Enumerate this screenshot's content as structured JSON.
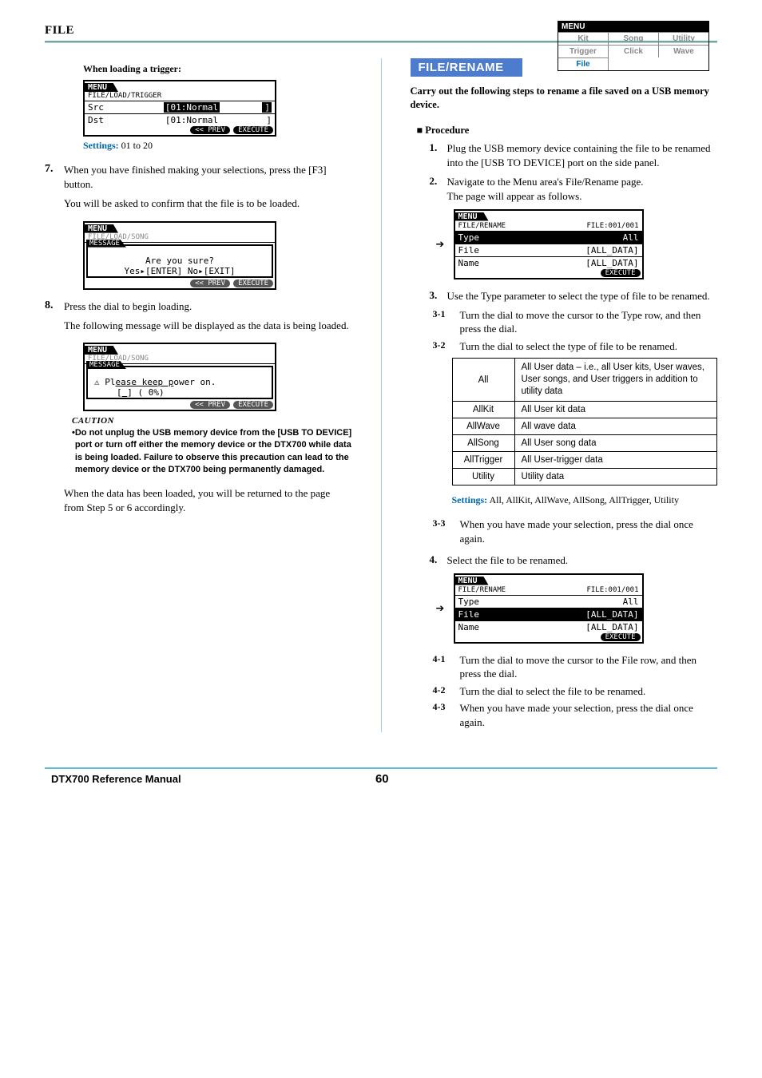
{
  "nav": {
    "title": "MENU",
    "row1": [
      "Kit",
      "Song",
      "Utility"
    ],
    "row2": [
      "Trigger",
      "Click",
      "Wave"
    ],
    "row3": [
      "File"
    ]
  },
  "sectionLabel": "FILE",
  "left": {
    "subhead": "When loading a trigger:",
    "lcd1": {
      "tab": "MENU",
      "path": "FILE/LOAD/TRIGGER",
      "srcLabel": "Src",
      "srcVal": "[01:Normal",
      "srcJ": "]",
      "dstLabel": "Dst",
      "dstVal": "[01:Normal",
      "dstJ": "]",
      "prev": "<< PREV",
      "exec": "EXECUTE"
    },
    "settings1_label": "Settings:",
    "settings1_val": "01 to 20",
    "step7_num": "7.",
    "step7_a": "When you have finished making your selections, press the [F3] button.",
    "step7_b": "You will be asked to confirm that the file is to be loaded.",
    "lcd2": {
      "tab": "MENU",
      "path": "FILE/LOAD/SONG",
      "msgTab": "MESSAGE",
      "line1": "Are you sure?",
      "line2": "Yes▸[ENTER] No▸[EXIT]",
      "prev": "<< PREV",
      "exec": "EXECUTE"
    },
    "step8_num": "8.",
    "step8_a": "Press the dial to begin loading.",
    "step8_b": "The following message will be displayed as the data is being loaded.",
    "lcd3": {
      "tab": "MENU",
      "path": "FILE/LOAD/SONG",
      "msgTab": "MESSAGE",
      "icon": "⚠",
      "line1a": "Pl",
      "line1b": "ease keep p",
      "line1c": "ower on.",
      "line2a": "[",
      "line2b": "          ",
      "line2c": "] (  0%)",
      "prev": "<< PREV",
      "exec": "EXECUTE"
    },
    "caution_h": "CAUTION",
    "caution_body": "Do not unplug the USB memory device from the [USB TO DEVICE] port or turn off either the memory device or the DTX700 while data is being loaded. Failure to observe this precaution can lead to the memory device or the DTX700 being permanently damaged.",
    "after": "When the data has been loaded, you will be returned to the page from Step 5 or 6 accordingly."
  },
  "right": {
    "heading": "FILE/RENAME",
    "desc": "Carry out the following steps to rename a file saved on a USB memory device.",
    "procH": "Procedure",
    "s1_num": "1.",
    "s1": "Plug the USB memory device containing the file to be renamed into the [USB TO DEVICE] port on the side panel.",
    "s2_num": "2.",
    "s2a": "Navigate to the Menu area's File/Rename page.",
    "s2b": "The page will appear as follows.",
    "lcdA": {
      "tab": "MENU",
      "pathL": "FILE/RENAME",
      "pathR": "FILE:001/001",
      "typeLab": "Type",
      "typeVal": "All",
      "fileLab": "File",
      "fileVal": "[ALL_DATA]",
      "nameLab": "Name",
      "nameVal": "[ALL_DATA]",
      "exec": "EXECUTE"
    },
    "s3_num": "3.",
    "s3": "Use the Type parameter to select the type of file to be renamed.",
    "s31_num": "3-1",
    "s31": "Turn the dial to move the cursor to the Type row, and then press the dial.",
    "s32_num": "3-2",
    "s32": "Turn the dial to select the type of file to be renamed.",
    "table": [
      [
        "All",
        "All User data – i.e., all User kits, User waves, User songs, and User triggers in addition to utility data"
      ],
      [
        "AllKit",
        "All User kit data"
      ],
      [
        "AllWave",
        "All wave data"
      ],
      [
        "AllSong",
        "All User song data"
      ],
      [
        "AllTrigger",
        "All User-trigger data"
      ],
      [
        "Utility",
        "Utility data"
      ]
    ],
    "settings_label": "Settings:",
    "settings_val": "All, AllKit, AllWave, AllSong, AllTrigger, Utility",
    "s33_num": "3-3",
    "s33": "When you have made your selection, press the dial once again.",
    "s4_num": "4.",
    "s4": "Select the file to be renamed.",
    "lcdB": {
      "tab": "MENU",
      "pathL": "FILE/RENAME",
      "pathR": "FILE:001/001",
      "typeLab": "Type",
      "typeVal": "All",
      "fileLab": "File",
      "fileVal": "[ALL_DATA]",
      "nameLab": "Name",
      "nameVal": "[ALL_DATA]",
      "exec": "EXECUTE"
    },
    "s41_num": "4-1",
    "s41": "Turn the dial to move the cursor to the File row, and then press the dial.",
    "s42_num": "4-2",
    "s42": "Turn the dial to select the file to be renamed.",
    "s43_num": "4-3",
    "s43": "When you have made your selection, press the dial once again."
  },
  "footer": {
    "left": "DTX700  Reference Manual",
    "page": "60"
  }
}
